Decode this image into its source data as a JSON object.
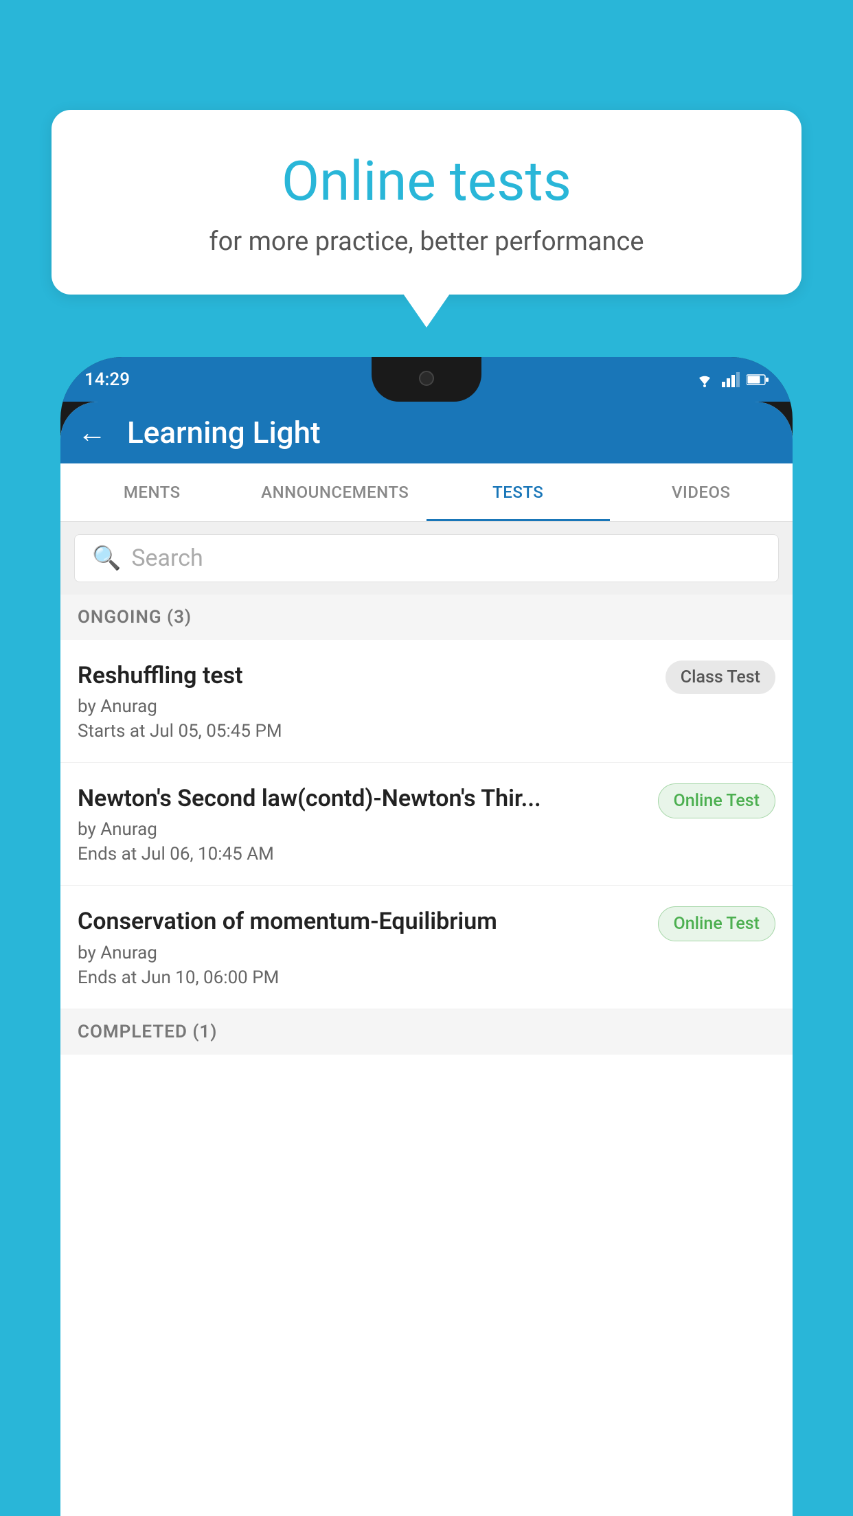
{
  "background": {
    "color": "#29B6D8"
  },
  "speech_bubble": {
    "title": "Online tests",
    "subtitle": "for more practice, better performance"
  },
  "phone": {
    "status_bar": {
      "time": "14:29",
      "icons": [
        "wifi",
        "signal",
        "battery"
      ]
    },
    "app_header": {
      "back_label": "←",
      "title": "Learning Light"
    },
    "tabs": [
      {
        "label": "MENTS",
        "active": false
      },
      {
        "label": "ANNOUNCEMENTS",
        "active": false
      },
      {
        "label": "TESTS",
        "active": true
      },
      {
        "label": "VIDEOS",
        "active": false
      }
    ],
    "search": {
      "placeholder": "Search"
    },
    "section_ongoing": {
      "label": "ONGOING (3)"
    },
    "tests": [
      {
        "title": "Reshuffling test",
        "author": "by Anurag",
        "date": "Starts at  Jul 05, 05:45 PM",
        "badge": "Class Test",
        "badge_type": "class"
      },
      {
        "title": "Newton's Second law(contd)-Newton's Thir...",
        "author": "by Anurag",
        "date": "Ends at  Jul 06, 10:45 AM",
        "badge": "Online Test",
        "badge_type": "online"
      },
      {
        "title": "Conservation of momentum-Equilibrium",
        "author": "by Anurag",
        "date": "Ends at  Jun 10, 06:00 PM",
        "badge": "Online Test",
        "badge_type": "online"
      }
    ],
    "section_completed": {
      "label": "COMPLETED (1)"
    }
  }
}
